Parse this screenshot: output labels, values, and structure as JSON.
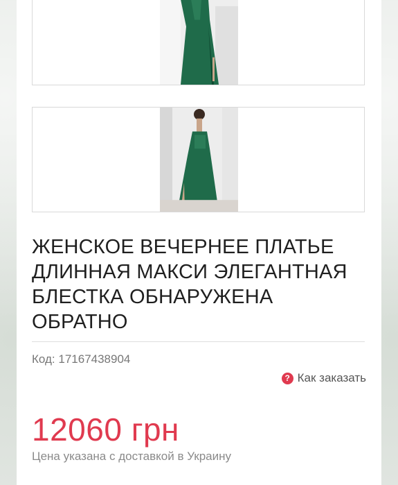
{
  "product": {
    "title": "ЖЕНСКОЕ ВЕЧЕРНЕЕ ПЛАТЬЕ ДЛИННАЯ МАКСИ ЭЛЕГАНТНАЯ БЛЕСТКА ОБНАРУЖЕНА ОБРАТНО",
    "sku_label": "Код:",
    "sku_value": "17167438904",
    "how_to_order": "Как заказать",
    "how_to_order_icon": "question-icon",
    "price": "12060 грн",
    "price_note": "Цена указана с доставкой в Украину"
  },
  "colors": {
    "accent": "#e03a4f",
    "top_tab": "#3a66c9",
    "dress": "#1f6b4a"
  }
}
